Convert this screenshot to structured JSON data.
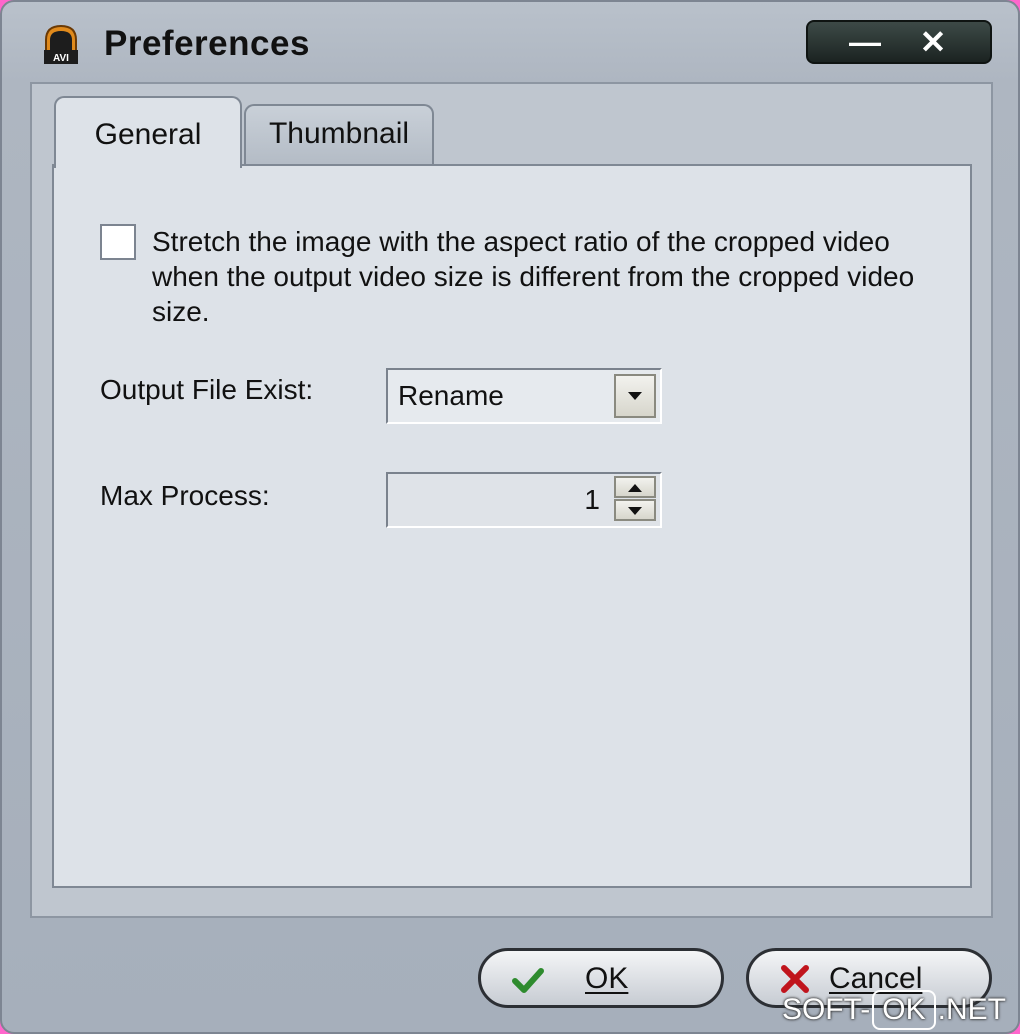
{
  "window": {
    "title": "Preferences",
    "app_icon_label": "AVI",
    "minimize_glyph": "—",
    "close_glyph": "✕"
  },
  "tabs": [
    {
      "label": "General",
      "active": true
    },
    {
      "label": "Thumbnail",
      "active": false
    }
  ],
  "general": {
    "stretch_checkbox": {
      "checked": false,
      "label_lines": [
        "Stretch the image with the aspect ratio of the cropped video",
        "when the output video size is different from the cropped video",
        "size."
      ]
    },
    "output_file_exist": {
      "label": "Output File Exist:",
      "value": "Rename"
    },
    "max_process": {
      "label": "Max Process:",
      "value": "1"
    }
  },
  "buttons": {
    "ok_label": "OK",
    "cancel_label": "Cancel"
  },
  "watermark": {
    "part1": "SOFT-",
    "part2": "OK",
    "part3": ".NET"
  },
  "colors": {
    "panel": "#dde2e8",
    "window": "#aeb6c1",
    "ok_check": "#2e8b2e",
    "cancel_x": "#c0141c"
  }
}
